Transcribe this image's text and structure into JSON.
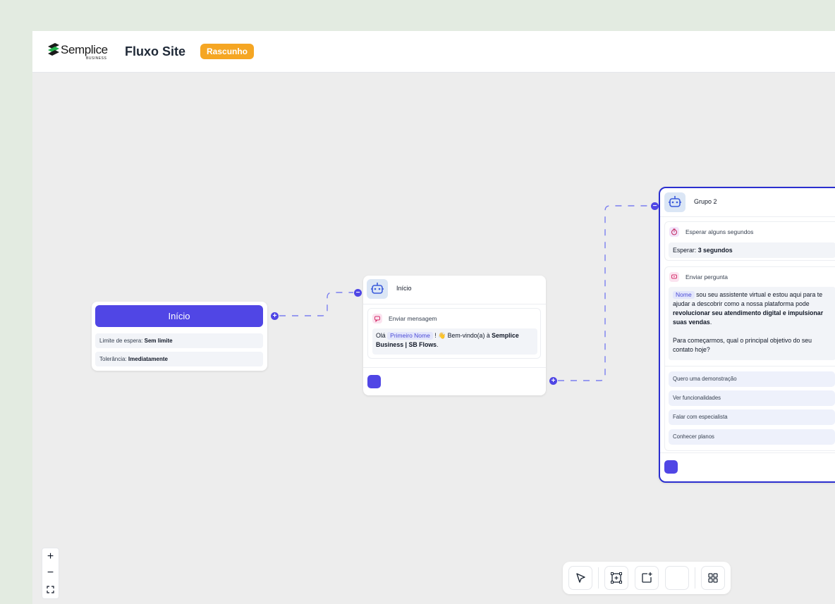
{
  "header": {
    "logo_text": "Semplice",
    "logo_subtext": "BUSINESS",
    "flow_title": "Fluxo Site",
    "status_badge": "Rascunho"
  },
  "start_node": {
    "title": "Início",
    "wait_limit_label": "Limite de espera:",
    "wait_limit_value": "Sem limite",
    "tolerance_label": "Tolerância:",
    "tolerance_value": "Imediatamente"
  },
  "group1": {
    "title": "Início",
    "block_label": "Enviar mensagem",
    "message": {
      "greeting": "Olá",
      "variable": "Primeiro Nome",
      "after_var": " ! 👋 Bem-vindo(a) à ",
      "bold": "Semplice Business | SB Flows",
      "end": "."
    }
  },
  "group2": {
    "title": "Grupo 2",
    "wait_block_label": "Esperar alguns segundos",
    "wait_prefix": "Esperar:",
    "wait_value": "3 segundos",
    "question_block_label": "Enviar pergunta",
    "question": {
      "variable": "Nome",
      "text1": " sou seu assistente virtual e estou aqui para te ajudar a descobrir como a nossa plataforma pode ",
      "bold": "revolucionar seu atendimento digital e impulsionar suas vendas",
      "text2": ".",
      "text3": "Para começarmos, qual o principal objetivo do seu contato hoje?"
    },
    "options": [
      "Quero uma demonstração",
      "Ver funcionalidades",
      "Falar com especialista",
      "Conhecer planos"
    ]
  },
  "zoom": {
    "zoom_in": "+",
    "zoom_out": "−"
  },
  "colors": {
    "primary": "#5046e5",
    "badge": "#f5a623",
    "selected_border": "#2b2fcf",
    "canvas": "#ededed"
  },
  "icons": [
    "robot-icon",
    "chat-icon",
    "timer-icon",
    "question-icon",
    "cursor-icon",
    "frame-icon",
    "add-note-icon",
    "grid-icon",
    "fit-view-icon"
  ]
}
